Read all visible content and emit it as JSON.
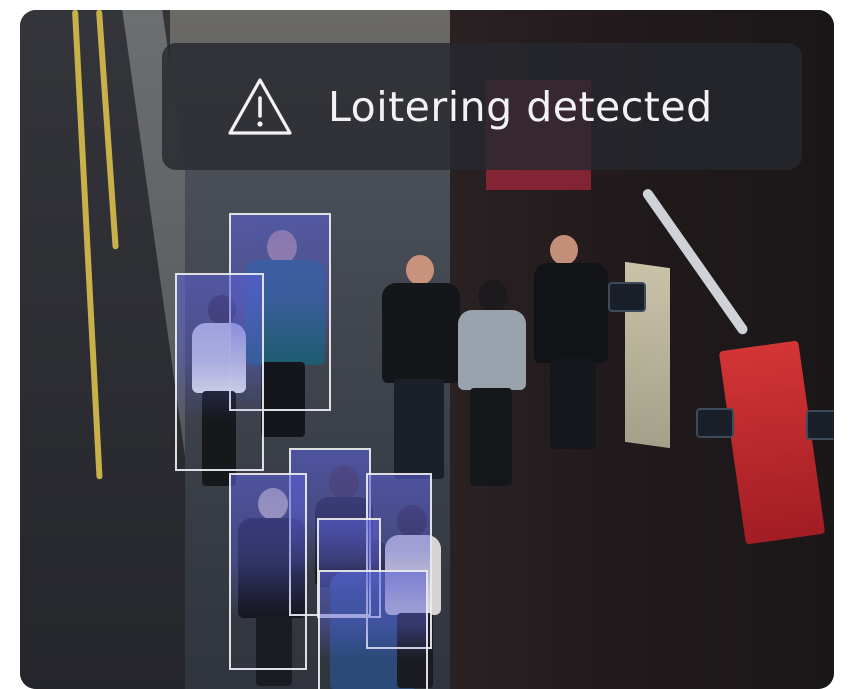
{
  "alert": {
    "icon": "warning-triangle-icon",
    "message": "Loitering detected",
    "background": "#26282e",
    "text_color": "#f2f2f4"
  },
  "detections": {
    "box_fill": "#5a5fd2",
    "box_border": "#ebebf0",
    "count": 7
  }
}
